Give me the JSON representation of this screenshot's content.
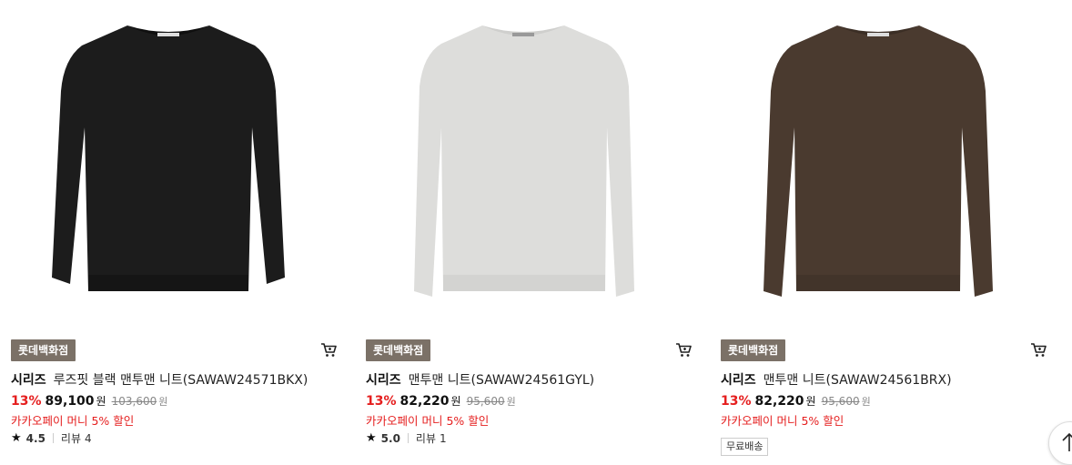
{
  "products": [
    {
      "store_badge": "롯데백화점",
      "brand": "시리즈",
      "name": "루즈핏 블랙 맨투맨 니트(SAWAW24571BKX)",
      "discount": "13%",
      "price": "89,100",
      "price_unit": "원",
      "original_price": "103,600",
      "original_unit": "원",
      "promo": "카카오페이 머니 5% 할인",
      "rating": "4.5",
      "reviews_label": "리뷰",
      "reviews_count": "4",
      "sweater_color": "#1c1c1c",
      "icons": [
        "cart-icon",
        "star-icon"
      ]
    },
    {
      "store_badge": "롯데백화점",
      "brand": "시리즈",
      "name": "맨투맨 니트(SAWAW24561GYL)",
      "discount": "13%",
      "price": "82,220",
      "price_unit": "원",
      "original_price": "95,600",
      "original_unit": "원",
      "promo": "카카오페이 머니 5% 할인",
      "rating": "5.0",
      "reviews_label": "리뷰",
      "reviews_count": "1",
      "sweater_color": "#dddddb",
      "icons": [
        "cart-icon",
        "star-icon"
      ]
    },
    {
      "store_badge": "롯데백화점",
      "brand": "시리즈",
      "name": "맨투맨 니트(SAWAW24561BRX)",
      "discount": "13%",
      "price": "82,220",
      "price_unit": "원",
      "original_price": "95,600",
      "original_unit": "원",
      "promo": "카카오페이 머니 5% 할인",
      "shipping_badge": "무료배송",
      "sweater_color": "#4a3a2f",
      "icons": [
        "cart-icon"
      ]
    }
  ],
  "scroll_top_icon": "arrow-up-icon",
  "colors": {
    "discount": "#e51e1e",
    "store_badge_bg": "#7b7167"
  }
}
